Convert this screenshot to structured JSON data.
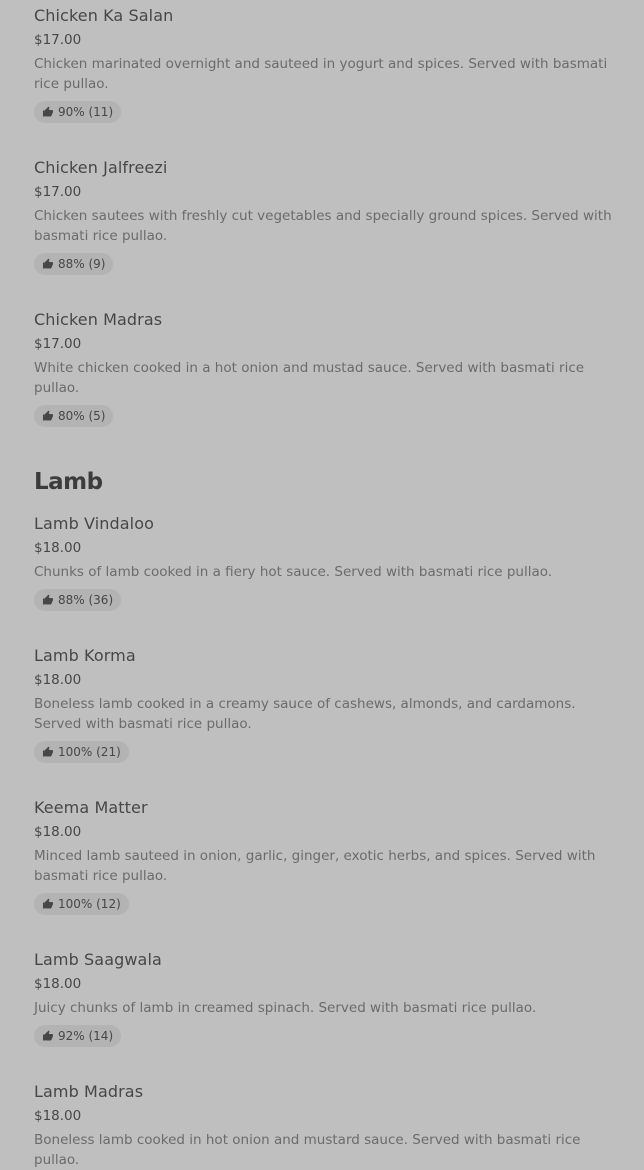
{
  "sections": [
    {
      "title": "",
      "items": [
        {
          "name": "Chicken Ka Salan",
          "price": "$17.00",
          "description": "Chicken marinated overnight and sauteed in yogurt and spices. Served with basmati rice pullao.",
          "rating": "90% (11)"
        },
        {
          "name": "Chicken Jalfreezi",
          "price": "$17.00",
          "description": "Chicken sautees with freshly cut vegetables and specially ground spices. Served with basmati rice pullao.",
          "rating": "88% (9)"
        },
        {
          "name": "Chicken Madras",
          "price": "$17.00",
          "description": "White chicken cooked in a hot onion and mustad sauce. Served with basmati rice pullao.",
          "rating": "80% (5)"
        }
      ]
    },
    {
      "title": "Lamb",
      "items": [
        {
          "name": "Lamb Vindaloo",
          "price": "$18.00",
          "description": "Chunks of lamb cooked in a fiery hot sauce. Served with basmati rice pullao.",
          "rating": "88% (36)"
        },
        {
          "name": "Lamb Korma",
          "price": "$18.00",
          "description": "Boneless lamb cooked in a creamy sauce of cashews, almonds, and cardamons. Served with basmati rice pullao.",
          "rating": "100% (21)"
        },
        {
          "name": "Keema Matter",
          "price": "$18.00",
          "description": "Minced lamb sauteed in onion, garlic, ginger, exotic herbs, and spices. Served with basmati rice pullao.",
          "rating": "100% (12)"
        },
        {
          "name": "Lamb Saagwala",
          "price": "$18.00",
          "description": "Juicy chunks of lamb in creamed spinach. Served with basmati rice pullao.",
          "rating": "92% (14)"
        },
        {
          "name": "Lamb Madras",
          "price": "$18.00",
          "description": "Boneless lamb cooked in hot onion and mustard sauce. Served with basmati rice pullao.",
          "rating": ""
        }
      ]
    }
  ],
  "icons": {
    "rating": "thumbs-up-icon"
  }
}
